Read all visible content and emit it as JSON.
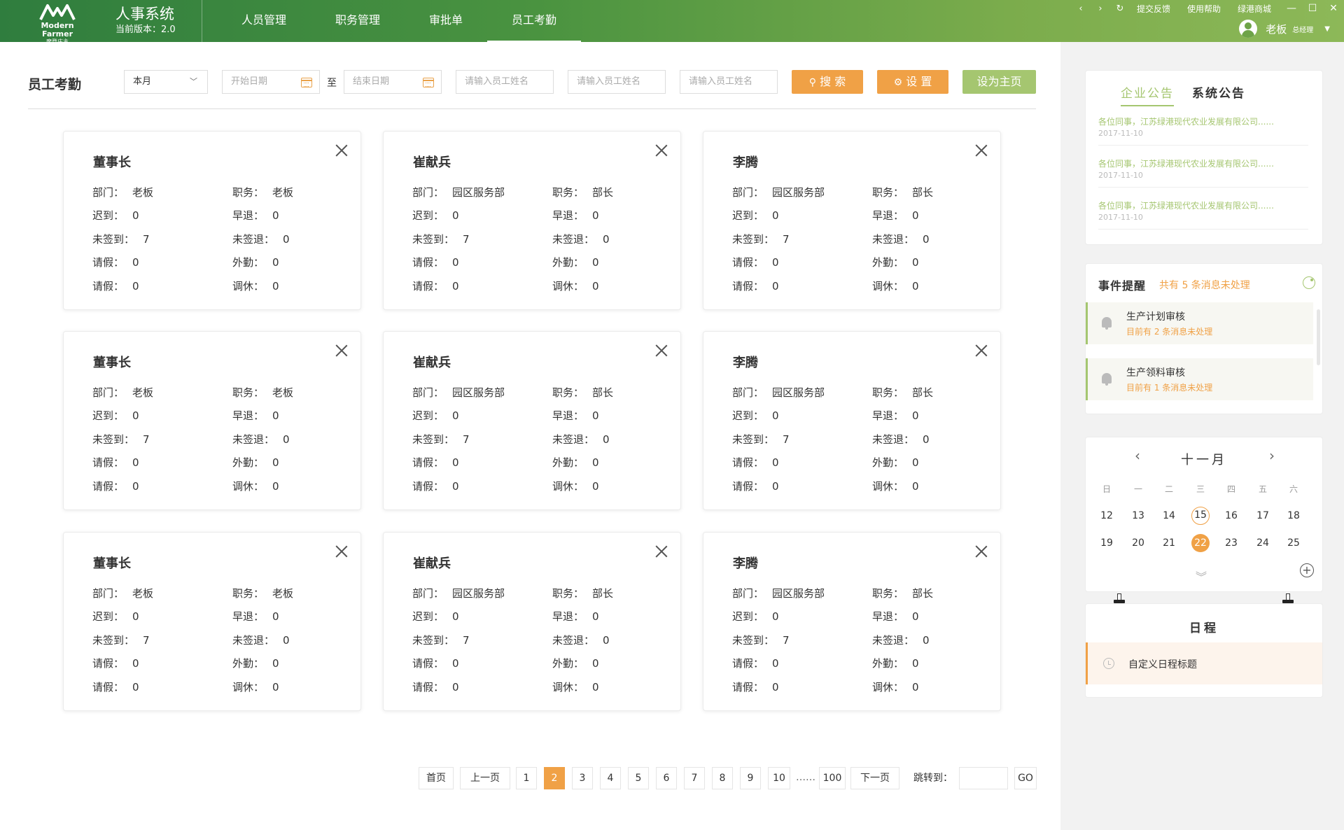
{
  "header": {
    "logo_text": "Modern Farmer",
    "logo_sub": "摩登庄主",
    "system_name": "人事系统",
    "version": "当前版本：2.0",
    "nav": [
      {
        "label": "人员管理"
      },
      {
        "label": "职务管理"
      },
      {
        "label": "审批单"
      },
      {
        "label": "员工考勤",
        "active": true
      }
    ],
    "links": [
      "提交反馈",
      "使用帮助",
      "绿港商城"
    ],
    "user_name": "老板",
    "user_role": "总经理"
  },
  "filters": {
    "title": "员工考勤",
    "period": "本月",
    "start_placeholder": "开始日期",
    "to_label": "至",
    "end_placeholder": "结束日期",
    "name_placeholders": [
      "请输入员工姓名",
      "请输入员工姓名",
      "请输入员工姓名"
    ],
    "search_label": "搜 索",
    "settings_label": "设 置",
    "home_label": "设为主页"
  },
  "labels": {
    "dept": "部门：",
    "position": "职务：",
    "late": "迟到：",
    "early": "早退：",
    "no_in": "未签到：",
    "no_out": "未签退：",
    "leave": "请假：",
    "out": "外勤：",
    "leave2": "请假：",
    "rest": "调休："
  },
  "cards": [
    {
      "name": "董事长",
      "dept": "老板",
      "position": "老板",
      "late": "0",
      "early": "0",
      "no_in": "7",
      "no_out": "0",
      "leave": "0",
      "out": "0",
      "leave2": "0",
      "rest": "0"
    },
    {
      "name": "崔献兵",
      "dept": "园区服务部",
      "position": "部长",
      "late": "0",
      "early": "0",
      "no_in": "7",
      "no_out": "0",
      "leave": "0",
      "out": "0",
      "leave2": "0",
      "rest": "0"
    },
    {
      "name": "李腾",
      "dept": "园区服务部",
      "position": "部长",
      "late": "0",
      "early": "0",
      "no_in": "7",
      "no_out": "0",
      "leave": "0",
      "out": "0",
      "leave2": "0",
      "rest": "0"
    },
    {
      "name": "董事长",
      "dept": "老板",
      "position": "老板",
      "late": "0",
      "early": "0",
      "no_in": "7",
      "no_out": "0",
      "leave": "0",
      "out": "0",
      "leave2": "0",
      "rest": "0"
    },
    {
      "name": "崔献兵",
      "dept": "园区服务部",
      "position": "部长",
      "late": "0",
      "early": "0",
      "no_in": "7",
      "no_out": "0",
      "leave": "0",
      "out": "0",
      "leave2": "0",
      "rest": "0"
    },
    {
      "name": "李腾",
      "dept": "园区服务部",
      "position": "部长",
      "late": "0",
      "early": "0",
      "no_in": "7",
      "no_out": "0",
      "leave": "0",
      "out": "0",
      "leave2": "0",
      "rest": "0"
    },
    {
      "name": "董事长",
      "dept": "老板",
      "position": "老板",
      "late": "0",
      "early": "0",
      "no_in": "7",
      "no_out": "0",
      "leave": "0",
      "out": "0",
      "leave2": "0",
      "rest": "0"
    },
    {
      "name": "崔献兵",
      "dept": "园区服务部",
      "position": "部长",
      "late": "0",
      "early": "0",
      "no_in": "7",
      "no_out": "0",
      "leave": "0",
      "out": "0",
      "leave2": "0",
      "rest": "0"
    },
    {
      "name": "李腾",
      "dept": "园区服务部",
      "position": "部长",
      "late": "0",
      "early": "0",
      "no_in": "7",
      "no_out": "0",
      "leave": "0",
      "out": "0",
      "leave2": "0",
      "rest": "0"
    }
  ],
  "pagination": {
    "first": "首页",
    "prev": "上一页",
    "pages": [
      "1",
      "2",
      "3",
      "4",
      "5",
      "6",
      "7",
      "8",
      "9",
      "10"
    ],
    "current": "2",
    "ellipsis": "……",
    "last": "100",
    "next": "下一页",
    "jump_label": "跳转到：",
    "go": "GO"
  },
  "notices": {
    "tabs": [
      "企业公告",
      "系统公告"
    ],
    "items": [
      {
        "text": "各位同事，江苏绿港现代农业发展有限公司......",
        "date": "2017-11-10"
      },
      {
        "text": "各位同事，江苏绿港现代农业发展有限公司......",
        "date": "2017-11-10"
      },
      {
        "text": "各位同事，江苏绿港现代农业发展有限公司......",
        "date": "2017-11-10"
      }
    ]
  },
  "events": {
    "title": "事件提醒",
    "count_text": "共有 5 条消息未处理",
    "items": [
      {
        "title": "生产计划审核",
        "sub": "目前有  2  条消息未处理"
      },
      {
        "title": "生产领料审核",
        "sub": "目前有  1  条消息未处理"
      }
    ]
  },
  "calendar": {
    "month": "十一月",
    "weekdays": [
      "日",
      "一",
      "二",
      "三",
      "四",
      "五",
      "六"
    ],
    "weeks": [
      [
        "12",
        "13",
        "14",
        "15",
        "16",
        "17",
        "18"
      ],
      [
        "19",
        "20",
        "21",
        "22",
        "23",
        "24",
        "25"
      ]
    ],
    "today": "15",
    "selected": "22"
  },
  "schedule": {
    "title": "日程",
    "item": "自定义日程标题"
  },
  "colors": {
    "brand_green": "#4a9340",
    "accent_orange": "#f0a146",
    "accent_light_green": "#a5c670"
  }
}
